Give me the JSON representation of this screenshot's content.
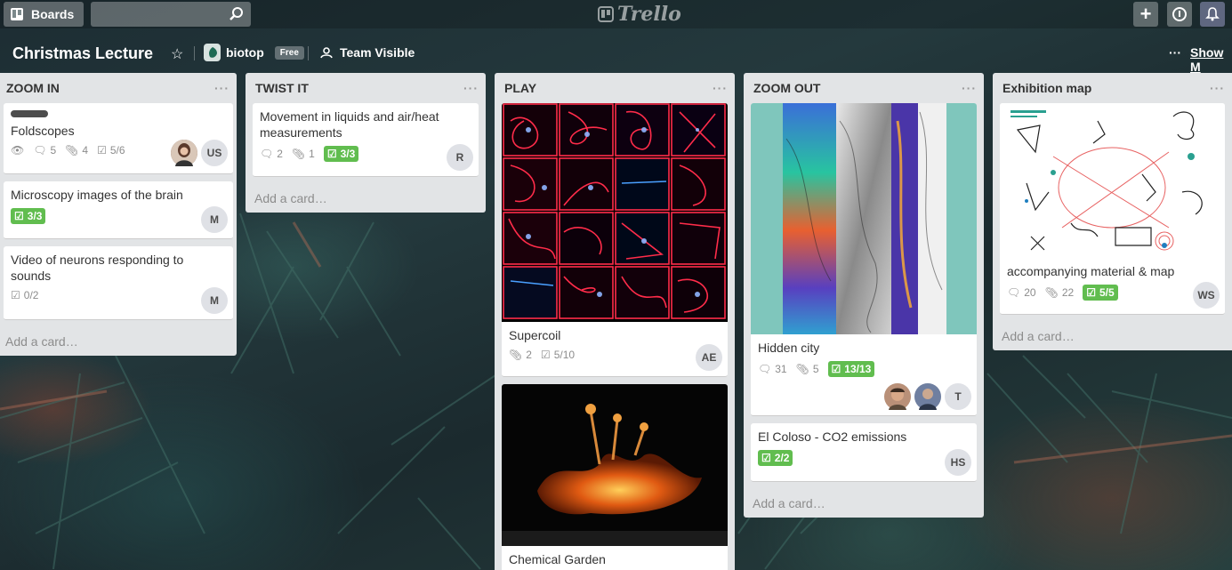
{
  "topbar": {
    "boards_label": "Boards",
    "search_placeholder": "",
    "logo_text": "Trello",
    "icons": [
      "boards-icon",
      "search-icon",
      "plus-icon",
      "info-icon",
      "bell-icon"
    ]
  },
  "board": {
    "title": "Christmas Lecture",
    "org_name": "biotop",
    "org_plan": "Free",
    "visibility": "Team Visible",
    "show_menu": "Show M",
    "show_menu_dots": "···"
  },
  "lists": [
    {
      "title": "ZOOM IN",
      "add_card": "Add a card…",
      "cards": [
        {
          "title": "Foldscopes",
          "comments": "5",
          "attachments": "4",
          "checklist": "5/6",
          "members": [
            "photo",
            "US"
          ]
        },
        {
          "title": "Microscopy images of the brain",
          "checklist": "3/3",
          "members": [
            "M"
          ]
        },
        {
          "title": "Video of neurons responding to sounds",
          "checklist": "0/2",
          "members": [
            "M"
          ]
        }
      ]
    },
    {
      "title": "TWIST IT",
      "add_card": "Add a card…",
      "cards": [
        {
          "title": "Movement in liquids and air/heat measurements",
          "comments": "2",
          "attachments": "1",
          "checklist": "3/3",
          "members": [
            "R"
          ]
        }
      ]
    },
    {
      "title": "PLAY",
      "cards": [
        {
          "title": "Supercoil",
          "attachments": "2",
          "checklist": "5/10",
          "members": [
            "AE"
          ]
        },
        {
          "title": "Chemical Garden"
        }
      ]
    },
    {
      "title": "ZOOM OUT",
      "add_card": "Add a card…",
      "cards": [
        {
          "title": "Hidden city",
          "comments": "31",
          "attachments": "5",
          "checklist": "13/13",
          "members": [
            "photo",
            "photo",
            "T"
          ]
        },
        {
          "title": "El Coloso - CO2 emissions",
          "checklist": "2/2",
          "members": [
            "HS"
          ]
        }
      ]
    },
    {
      "title": "Exhibition map",
      "add_card": "Add a card…",
      "cards": [
        {
          "title": "accompanying material & map",
          "comments": "20",
          "attachments": "22",
          "checklist": "5/5",
          "members": [
            "WS"
          ]
        }
      ]
    }
  ],
  "colors": {
    "checklist_done": "#61bd4f",
    "list_bg": "#e2e4e6",
    "teal_cover": "#7fc6bc"
  }
}
